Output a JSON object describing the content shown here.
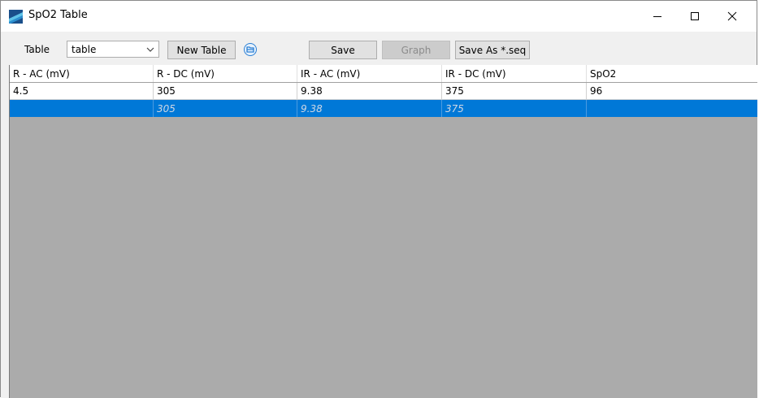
{
  "window": {
    "title": "SpO2 Table",
    "icon": "app-logo-icon",
    "controls": [
      "minimize-icon",
      "maximize-icon",
      "close-icon"
    ]
  },
  "toolbar": {
    "table_label": "Table",
    "table_select_value": "table",
    "new_table_label": "New Table",
    "open_icon": "folder-open-icon",
    "save_label": "Save",
    "graph_label": "Graph",
    "save_as_label": "Save As *.seq"
  },
  "grid": {
    "columns": [
      "R - AC (mV)",
      "R - DC (mV)",
      "IR - AC (mV)",
      "IR - DC (mV)",
      "SpO2"
    ],
    "rows": [
      [
        "4.5",
        "305",
        "9.38",
        "375",
        "96"
      ],
      [
        "",
        "305",
        "9.38",
        "375",
        ""
      ]
    ]
  },
  "colors": {
    "selection": "#0078d7",
    "grid_background": "#ababab"
  }
}
